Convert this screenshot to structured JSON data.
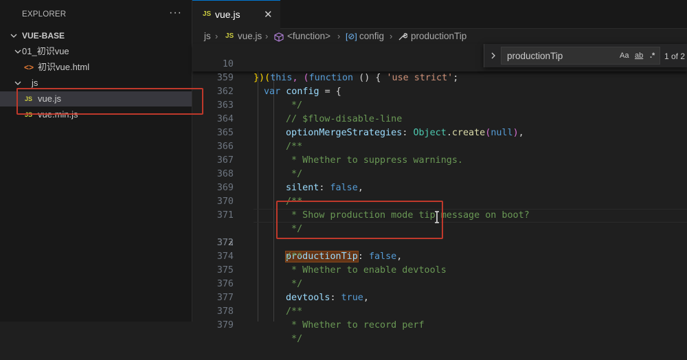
{
  "sidebar": {
    "title": "EXPLORER",
    "more_icon": "ellipsis-icon",
    "root_folder": "VUE-BASE",
    "folders": [
      {
        "label": "01_初识vue",
        "file": "初识vue.html"
      },
      {
        "label": "js"
      }
    ],
    "files": {
      "html_file": "初识vue.html",
      "vue_js": "vue.js",
      "vue_min_js": "vue.min.js"
    },
    "file_badge": "JS",
    "html_badge": "<>"
  },
  "tab": {
    "badge": "JS",
    "label": "vue.js",
    "close": "✕"
  },
  "breadcrumb": {
    "items": [
      "js",
      "vue.js",
      "<function>",
      "config",
      "productionTip"
    ],
    "js_badge": "JS"
  },
  "find": {
    "value": "productionTip",
    "match_case": "Aa",
    "whole_word": "ab",
    "regex": ".*",
    "count": "1 of 2"
  },
  "code": {
    "sticky_lines": [
      {
        "n": "10"
      },
      {
        "n": "359"
      }
    ],
    "lines": [
      {
        "n": "362",
        "text": "*/"
      },
      {
        "n": "363",
        "text": "// $flow-disable-line"
      },
      {
        "n": "364",
        "prop": "optionMergeStrategies",
        "obj": "Object",
        "method": "create",
        "arg": "null"
      },
      {
        "n": "365",
        "text": "/**"
      },
      {
        "n": "366",
        "text": " * Whether to suppress warnings."
      },
      {
        "n": "367",
        "text": " */"
      },
      {
        "n": "368",
        "prop": "silent",
        "val": "false"
      },
      {
        "n": "369",
        "text": "/**"
      },
      {
        "n": "370",
        "text": " * Show production mode tip message on boot?"
      },
      {
        "n": "371",
        "text": " */"
      },
      {
        "n": "372",
        "prop": "productionTip",
        "val": "false"
      },
      {
        "n": "373",
        "text": "/**"
      },
      {
        "n": "374",
        "text": " * Whether to enable devtools"
      },
      {
        "n": "375",
        "text": " */"
      },
      {
        "n": "376",
        "prop": "devtools",
        "val": "true"
      },
      {
        "n": "377",
        "text": "/**"
      },
      {
        "n": "378",
        "text": " * Whether to record perf"
      },
      {
        "n": "379",
        "text": " */"
      }
    ],
    "sticky_text": {
      "l10_a": "})(",
      "l10_this": "this",
      "l10_b": ", (",
      "l10_function": "function",
      "l10_c": " () { ",
      "l10_str": "'use strict'",
      "l10_d": ";",
      "l359_var": "var",
      "l359_name": "config",
      "l359_eq": " = {"
    }
  },
  "colors": {
    "accent": "#0078d4",
    "highlight_box": "#c0392b",
    "find_match": "#623315"
  }
}
